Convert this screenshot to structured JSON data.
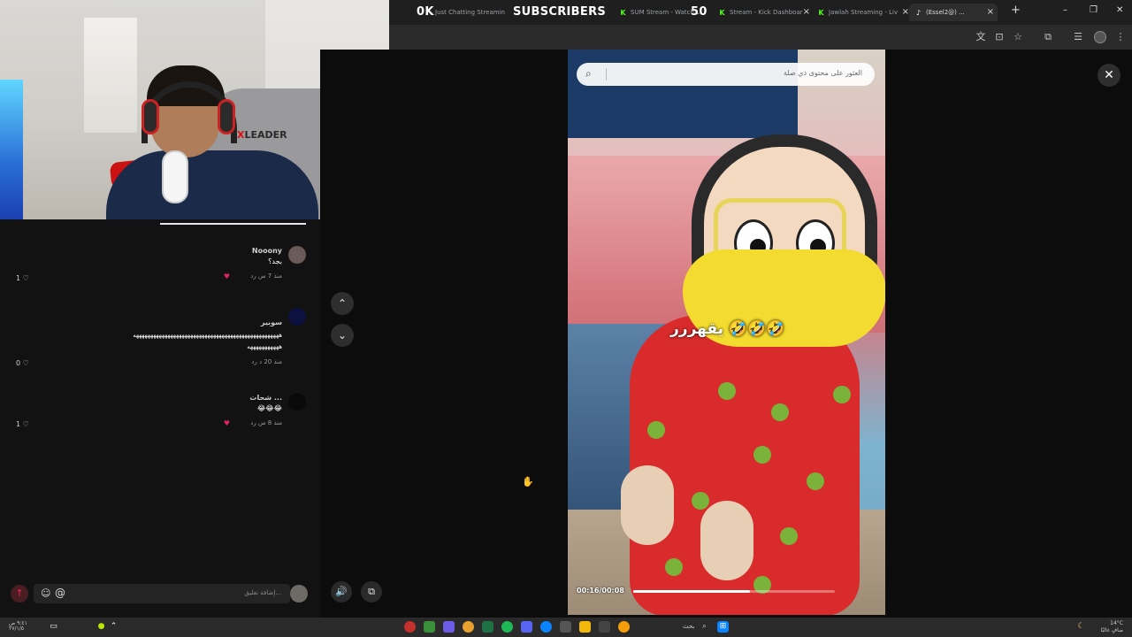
{
  "browser": {
    "tabs": [
      {
        "label": "Just Chatting Streamin",
        "favicon": "K"
      },
      {
        "label": "SUM Stream - Watch L",
        "favicon": "K"
      },
      {
        "label": "Stream - Kick Dashboar",
        "favicon": "K"
      },
      {
        "label": "Jawlah Streaming - Liv",
        "favicon": "K"
      },
      {
        "label": "(Essel2@) ...",
        "favicon": "tiktok",
        "active": true
      }
    ],
    "overlay": {
      "count_left": "0K",
      "subscribers_label": "SUBSCRIBERS",
      "count_right": "50"
    },
    "new_tab": "+",
    "window_controls": {
      "minimize": "–",
      "restore": "❐",
      "close": "✕"
    }
  },
  "comments": {
    "items": [
      {
        "user": "Nooony",
        "text": "بجد؟",
        "time": "منذ 7 س",
        "reply": "رد",
        "likes": "1",
        "creator_liked": true
      },
      {
        "user": "سوبير",
        "text": "هههههههههههههههههههههههههههههههههههههههههههههههههههه",
        "text2": "هههههههههههه",
        "time": "منذ 20 د",
        "reply": "رد",
        "likes": "0",
        "creator_liked": false
      },
      {
        "user": "شحات ...",
        "text": "😂😂😂",
        "time": "منذ 8 س",
        "reply": "رد",
        "likes": "1",
        "creator_liked": true
      }
    ],
    "input_placeholder": "إضافة تعليق...",
    "emoji_glyph": "☺",
    "mention_glyph": "@",
    "send_glyph": "↑"
  },
  "viewer": {
    "search_placeholder": "العثور على محتوى ذي صلة",
    "caption": "يقهررر 🤣🤣🤣",
    "time": "00:16/00:08",
    "progress": 0.58,
    "close_glyph": "✕",
    "prev_glyph": "⌃",
    "next_glyph": "⌄",
    "volume_glyph": "🔊",
    "pip_glyph": "⧉"
  },
  "webcam": {
    "chair_brand_prefix": "X",
    "chair_brand": "LEADER"
  },
  "taskbar": {
    "search_label": "بحث",
    "weather": "14°C",
    "weather_desc": "صافٍ غالبًا",
    "clock_time": "٩:٤١ ص",
    "clock_date": "٢٧/١/٥"
  }
}
